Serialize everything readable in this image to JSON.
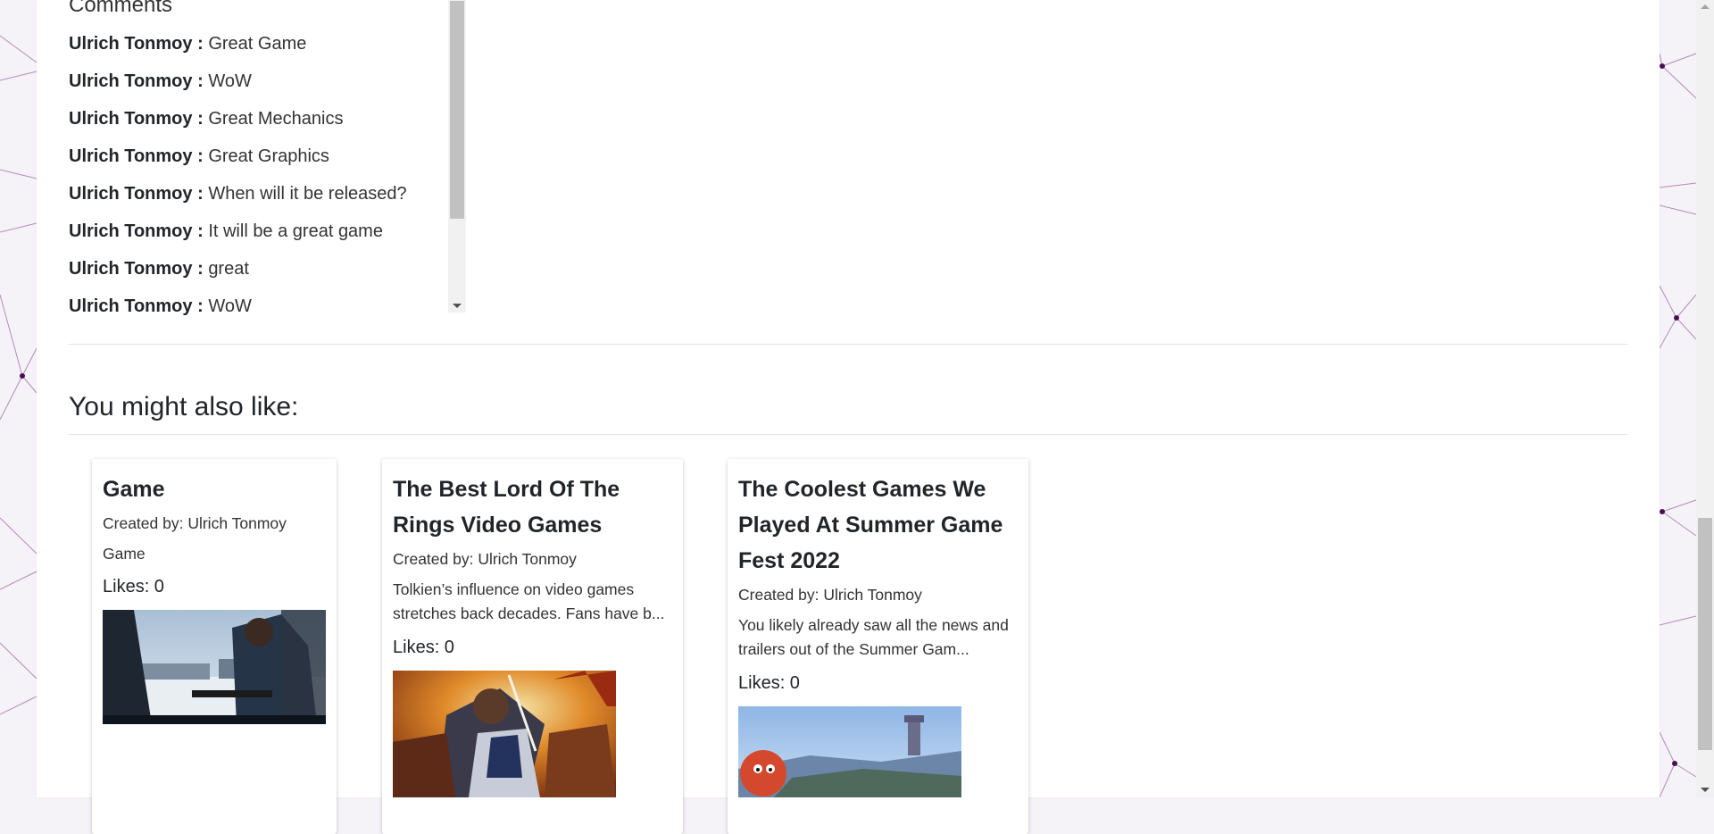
{
  "comments": {
    "heading": "Comments",
    "items": [
      {
        "author": "Ulrich Tonmoy :",
        "text": "Great Game"
      },
      {
        "author": "Ulrich Tonmoy :",
        "text": "WoW"
      },
      {
        "author": "Ulrich Tonmoy :",
        "text": "Great Mechanics"
      },
      {
        "author": "Ulrich Tonmoy :",
        "text": "Great Graphics"
      },
      {
        "author": "Ulrich Tonmoy :",
        "text": "When will it be released?"
      },
      {
        "author": "Ulrich Tonmoy :",
        "text": "It will be a great game"
      },
      {
        "author": "Ulrich Tonmoy :",
        "text": "great"
      },
      {
        "author": "Ulrich Tonmoy :",
        "text": "WoW"
      }
    ]
  },
  "recommendations": {
    "title": "You might also like:",
    "cards": [
      {
        "title_line1": "Game",
        "title_line2": "",
        "title_line3": "",
        "created_by": "Created by: Ulrich Tonmoy",
        "desc_line1": "Game",
        "desc_line2": "",
        "likes": "Likes: 0"
      },
      {
        "title_line1": "The Best Lord Of The",
        "title_line2": "Rings Video Games",
        "title_line3": "",
        "created_by": "Created by: Ulrich Tonmoy",
        "desc_line1": "Tolkien’s influence on video games",
        "desc_line2": "stretches back decades. Fans have b...",
        "likes": "Likes: 0"
      },
      {
        "title_line1": "The Coolest Games We",
        "title_line2": "Played At Summer Game",
        "title_line3": "Fest 2022",
        "created_by": "Created by: Ulrich Tonmoy",
        "desc_line1": "You likely already saw all the news and",
        "desc_line2": "trailers out of the Summer Gam...",
        "likes": "Likes: 0"
      }
    ]
  },
  "colors": {
    "background": "#f6f3f8",
    "network_lines": "#9b6aa8",
    "network_nodes": "#4a0f4f"
  }
}
